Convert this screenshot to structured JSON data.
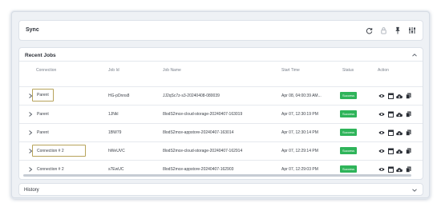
{
  "sync": {
    "title": "Sync",
    "icons": [
      "refresh-icon",
      "lock-icon",
      "pin-icon",
      "filter-settings-icon"
    ]
  },
  "jobs": {
    "title": "Recent Jobs",
    "columns": [
      "Connection",
      "Job Id",
      "Job Name",
      "Start Time",
      "Status",
      "Action"
    ],
    "rows": [
      {
        "connection": "Parent",
        "job_id": "HG-pDnns8",
        "job_name": "JJ2qSc7z-s3-20240408-080039",
        "start_time": "Apr 08, 04:00:39 AM...",
        "status": "Success"
      },
      {
        "connection": "Parent",
        "job_id": "1JNkl",
        "job_name": "8lodS2mce-cloud-storage-20240407-163019",
        "start_time": "Apr 07, 12:30:19 PM",
        "status": "Success"
      },
      {
        "connection": "Parent",
        "job_id": "1BW79",
        "job_name": "8lodS2mce-appstore-20240407-163014",
        "start_time": "Apr 07, 12:30:14 PM",
        "status": "Success"
      },
      {
        "connection": "Connection # 2",
        "job_id": "hWeUVC",
        "job_name": "8lodS2mce-cloud-storage-20240407-162914",
        "start_time": "Apr 07, 12:29:14 PM",
        "status": "Success"
      },
      {
        "connection": "Connection # 2",
        "job_id": "s7EwUC",
        "job_name": "8lodS2mce-appstore-20240407-162903",
        "start_time": "Apr 07, 12:29:03 PM",
        "status": "Success"
      }
    ],
    "action_icons": [
      "view-icon",
      "calendar-icon",
      "cloud-download-icon",
      "copy-icon"
    ]
  },
  "history": {
    "title": "History"
  },
  "colors": {
    "success": "#2fb45a",
    "highlight_border": "#b7a35a"
  }
}
